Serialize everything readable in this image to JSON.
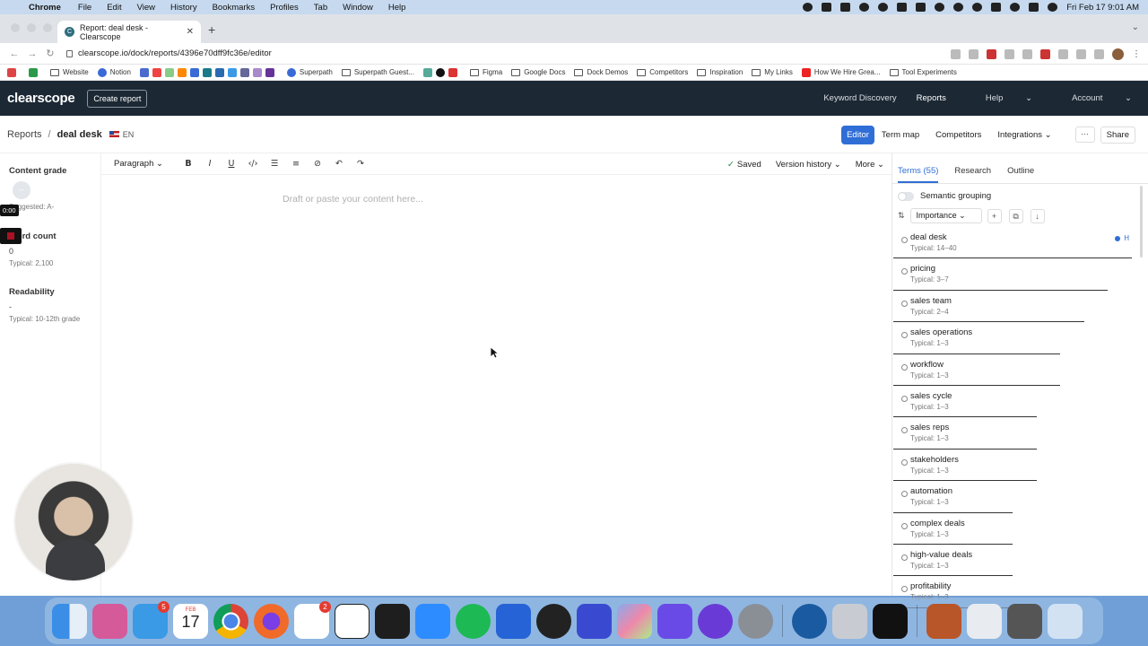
{
  "menubar": {
    "app": "Chrome",
    "items": [
      "File",
      "Edit",
      "View",
      "History",
      "Bookmarks",
      "Profiles",
      "Tab",
      "Window",
      "Help"
    ],
    "datetime": "Fri Feb 17  9:01 AM"
  },
  "browser": {
    "tab_title": "Report: deal desk - Clearscope",
    "url": "clearscope.io/dock/reports/4396e70dff9fc36e/editor",
    "bookmarks": [
      "Website",
      "Notion",
      "Superpath",
      "Superpath Guest...",
      "Figma",
      "Google Docs",
      "Dock Demos",
      "Competitors",
      "Inspiration",
      "My Links",
      "How We Hire Grea...",
      "Tool Experiments"
    ]
  },
  "app": {
    "logo": "clearscope",
    "create_report": "Create report",
    "nav": [
      "Keyword Discovery",
      "Reports",
      "Help",
      "Account"
    ]
  },
  "subheader": {
    "crumb_root": "Reports",
    "crumb_sep": "/",
    "crumb_current": "deal desk",
    "lang": "EN",
    "tabs": [
      "Editor",
      "Term map",
      "Competitors",
      "Integrations"
    ],
    "more": "···",
    "share": "Share"
  },
  "metrics": {
    "content_grade": {
      "title": "Content grade",
      "dot": "–",
      "sub": "Suggested: A-"
    },
    "word_count": {
      "title": "Word count",
      "value": "0",
      "sub": "Typical: 2,100"
    },
    "readability": {
      "title": "Readability",
      "value": "-",
      "sub": "Typical: 10-12th grade"
    }
  },
  "editor": {
    "block_type": "Paragraph",
    "saved": "Saved",
    "version_history": "Version history",
    "more": "More",
    "placeholder": "Draft or paste your content here..."
  },
  "panel": {
    "tabs": [
      "Terms (55)",
      "Research",
      "Outline"
    ],
    "semantic_grouping": "Semantic grouping",
    "sort": "Importance",
    "terms": [
      {
        "name": "deal desk",
        "typical": "Typical: 14–40",
        "importance": 1.0,
        "tag": "H"
      },
      {
        "name": "pricing",
        "typical": "Typical: 3–7",
        "importance": 0.9
      },
      {
        "name": "sales team",
        "typical": "Typical: 2–4",
        "importance": 0.8
      },
      {
        "name": "sales operations",
        "typical": "Typical: 1–3",
        "importance": 0.7
      },
      {
        "name": "workflow",
        "typical": "Typical: 1–3",
        "importance": 0.7
      },
      {
        "name": "sales cycle",
        "typical": "Typical: 1–3",
        "importance": 0.6
      },
      {
        "name": "sales reps",
        "typical": "Typical: 1–3",
        "importance": 0.6
      },
      {
        "name": "stakeholders",
        "typical": "Typical: 1–3",
        "importance": 0.6
      },
      {
        "name": "automation",
        "typical": "Typical: 1–3",
        "importance": 0.5
      },
      {
        "name": "complex deals",
        "typical": "Typical: 1–3",
        "importance": 0.5
      },
      {
        "name": "high-value deals",
        "typical": "Typical: 1–3",
        "importance": 0.5
      },
      {
        "name": "profitability",
        "typical": "Typical: 1–3",
        "importance": 0.5
      }
    ]
  },
  "overlay": {
    "timer": "0:00"
  },
  "dock": {
    "mail_badge": "5",
    "calendar_month": "FEB",
    "calendar_day": "17",
    "slack_badge": "2"
  }
}
